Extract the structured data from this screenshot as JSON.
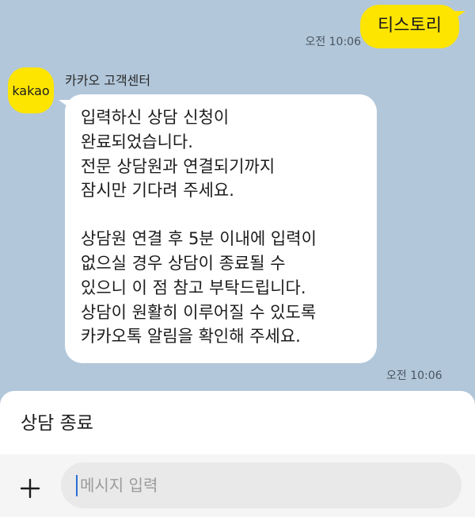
{
  "outgoing": {
    "text": "티스토리",
    "time": "오전 10:06"
  },
  "incoming": {
    "sender": "카카오 고객센터",
    "avatar_text": "kakao",
    "paragraph1": "입력하신 상담 신청이\n완료되었습니다.\n전문 상담원과 연결되기까지\n잠시만 기다려 주세요.",
    "paragraph2": "상담원 연결 후 5분 이내에 입력이\n없으실 경우 상담이 종료될 수\n있으니 이 점 참고 부탁드립니다.\n상담이 원활히 이루어질 수 있도록\n카카오톡 알림을 확인해 주세요.",
    "time": "오전 10:06"
  },
  "end_chat": {
    "label": "상담 종료"
  },
  "composer": {
    "placeholder": "메시지 입력",
    "plus_icon": "plus-icon"
  },
  "colors": {
    "background": "#b2c7da",
    "outgoing_bubble": "#fee500",
    "incoming_bubble": "#ffffff",
    "caret": "#2a6fd6"
  }
}
